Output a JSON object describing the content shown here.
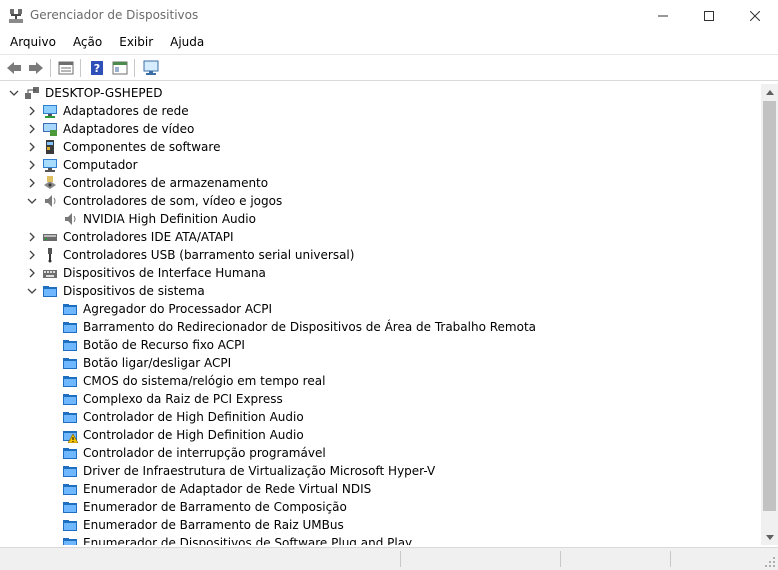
{
  "window": {
    "title": "Gerenciador de Dispositivos"
  },
  "menu": [
    "Arquivo",
    "Ação",
    "Exibir",
    "Ajuda"
  ],
  "toolbar": [
    "back-icon",
    "forward-icon",
    "properties-icon",
    "help-icon",
    "view-icon",
    "monitor-scan-icon"
  ],
  "tree": {
    "root": "DESKTOP-GSHEPED",
    "items": [
      {
        "label": "Adaptadores de rede",
        "depth": 1,
        "state": "collapsed",
        "icon": "network-adapter"
      },
      {
        "label": "Adaptadores de vídeo",
        "depth": 1,
        "state": "collapsed",
        "icon": "display-adapter"
      },
      {
        "label": "Componentes de software",
        "depth": 1,
        "state": "collapsed",
        "icon": "software-component"
      },
      {
        "label": "Computador",
        "depth": 1,
        "state": "collapsed",
        "icon": "computer"
      },
      {
        "label": "Controladores de armazenamento",
        "depth": 1,
        "state": "collapsed",
        "icon": "storage"
      },
      {
        "label": "Controladores de som, vídeo e jogos",
        "depth": 1,
        "state": "expanded",
        "icon": "speaker"
      },
      {
        "label": "NVIDIA High Definition Audio",
        "depth": 2,
        "state": "leaf",
        "icon": "speaker"
      },
      {
        "label": "Controladores IDE ATA/ATAPI",
        "depth": 1,
        "state": "collapsed",
        "icon": "ide"
      },
      {
        "label": "Controladores USB (barramento serial universal)",
        "depth": 1,
        "state": "collapsed",
        "icon": "usb"
      },
      {
        "label": "Dispositivos de Interface Humana",
        "depth": 1,
        "state": "collapsed",
        "icon": "hid"
      },
      {
        "label": "Dispositivos de sistema",
        "depth": 1,
        "state": "expanded",
        "icon": "system-folder"
      },
      {
        "label": "Agregador do Processador ACPI",
        "depth": 2,
        "state": "leaf",
        "icon": "system-device"
      },
      {
        "label": "Barramento do Redirecionador de Dispositivos de Área de Trabalho Remota",
        "depth": 2,
        "state": "leaf",
        "icon": "system-device"
      },
      {
        "label": "Botão de Recurso fixo ACPI",
        "depth": 2,
        "state": "leaf",
        "icon": "system-device"
      },
      {
        "label": "Botão ligar/desligar ACPI",
        "depth": 2,
        "state": "leaf",
        "icon": "system-device"
      },
      {
        "label": "CMOS do sistema/relógio em tempo real",
        "depth": 2,
        "state": "leaf",
        "icon": "system-device"
      },
      {
        "label": "Complexo da Raiz de PCI Express",
        "depth": 2,
        "state": "leaf",
        "icon": "system-device"
      },
      {
        "label": "Controlador de High Definition Audio",
        "depth": 2,
        "state": "leaf",
        "icon": "system-device"
      },
      {
        "label": "Controlador de High Definition Audio",
        "depth": 2,
        "state": "leaf",
        "icon": "system-device-warning"
      },
      {
        "label": "Controlador de interrupção programável",
        "depth": 2,
        "state": "leaf",
        "icon": "system-device"
      },
      {
        "label": "Driver de Infraestrutura de Virtualização Microsoft Hyper-V",
        "depth": 2,
        "state": "leaf",
        "icon": "system-device"
      },
      {
        "label": "Enumerador de Adaptador de Rede Virtual NDIS",
        "depth": 2,
        "state": "leaf",
        "icon": "system-device"
      },
      {
        "label": "Enumerador de Barramento de Composição",
        "depth": 2,
        "state": "leaf",
        "icon": "system-device"
      },
      {
        "label": "Enumerador de Barramento de Raiz UMBus",
        "depth": 2,
        "state": "leaf",
        "icon": "system-device"
      },
      {
        "label": "Enumerador de Dispositivos de Software Plug and Play",
        "depth": 2,
        "state": "leaf",
        "icon": "system-device"
      }
    ]
  }
}
